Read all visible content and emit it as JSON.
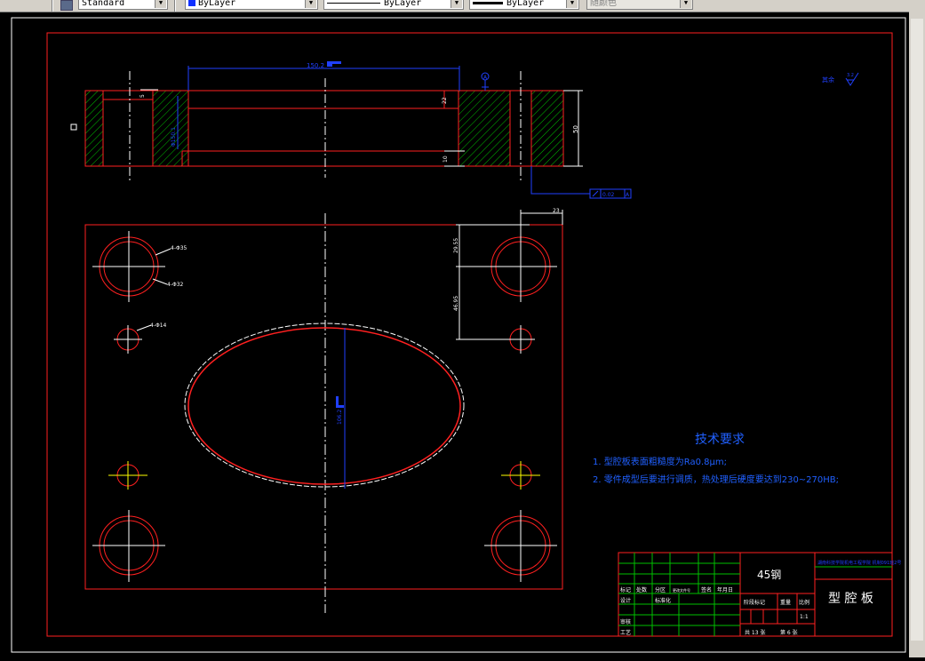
{
  "toolbar": {
    "text_style": "Standard",
    "color": "ByLayer",
    "linetype": "ByLayer",
    "lineweight": "ByLayer",
    "plot_style": "随颜色"
  },
  "drawing": {
    "title_block": {
      "material": "45钢",
      "part_name": "型 腔 板",
      "school_name": "湖南科技学院机电工程学院 机制091班2号",
      "scale": "1:1",
      "headers": [
        "标记",
        "处数",
        "分区",
        "更改文件号",
        "签名",
        "年月日"
      ],
      "rows": [
        "设计",
        "审核",
        "工艺"
      ],
      "rows2": [
        "标准化",
        "阶段标记",
        "重量",
        "比例"
      ],
      "sheet_total": "共 13 张",
      "sheet_no": "第 6 张"
    },
    "tech_requirements": {
      "title": "技术要求",
      "items": [
        "1. 型腔板表面粗糙度为Ra0.8μm;",
        "2. 零件成型后要进行调质，热处理后硬度要达到230~270HB;"
      ]
    },
    "roughness_note": "其余",
    "roughness_value": "3.2",
    "dimensions": {
      "top_width": "150.2",
      "depth_5": "5",
      "dim_22": "22",
      "dim_10": "10",
      "dim_50": "50",
      "dim_23": "23",
      "dim_29_55": "29.55",
      "dim_46_95": "46.95",
      "dim_106_2": "106.2",
      "ellipse_height": "106.2",
      "bore_label": "Φ150.1",
      "holes_large_a": "4-Φ35",
      "holes_large_b": "4-Φ32",
      "holes_small": "4-Φ14",
      "tolerance": "0.02",
      "datum": "A",
      "datum_mark": "A"
    }
  }
}
